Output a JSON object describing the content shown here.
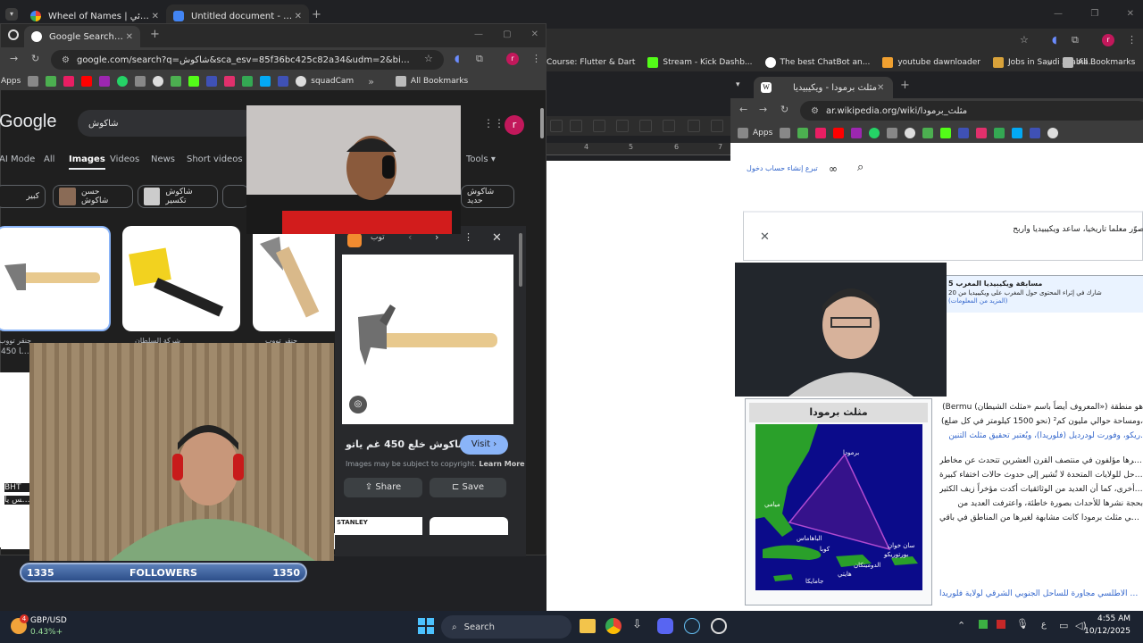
{
  "back_window": {
    "tabs": [
      {
        "label": "Wheel of Names | عجلة الأسم العشوائي"
      },
      {
        "label": "Untitled document - Google Do"
      }
    ],
    "bookmarks": [
      "Course: Flutter & Dart",
      "Stream - Kick Dashb...",
      "The best ChatBot an...",
      "youtube dawnloader",
      "Jobs in Saudi Arabia..."
    ],
    "all_bookmarks": "All Bookmarks",
    "ruler_marks": [
      "4",
      "5",
      "6",
      "7"
    ]
  },
  "google_window": {
    "tab_title": "Google Search - شاكوش",
    "url": "google.com/search?q=شاكوش&sca_esv=85f36bc425c82a34&udm=2&biw=952&bih=783...",
    "bookmarks": [
      "Apps",
      "squadCam"
    ],
    "all_bookmarks": "All Bookmarks",
    "logo": "Google",
    "query": "شاكوش",
    "avatar": "r",
    "tabs": [
      "AI Mode",
      "All",
      "Images",
      "Videos",
      "News",
      "Short videos"
    ],
    "tools": "Tools",
    "chips": [
      "كبير",
      "حسن شاكوش",
      "شاكوش تكسير",
      "شاكوش حديد"
    ],
    "result_sources": [
      "شركة السلطان",
      "جنقر تووب",
      "جنقر تووب"
    ],
    "result_snippet": "جنقر تووب",
    "left_snippets": [
      "450 عم يا",
      "BHT",
      "بولكس يا"
    ],
    "panel": {
      "source": "توب",
      "title": "شاكوش خلع 450 غم ياتو",
      "visit": "Visit",
      "copyright": "Images may be subject to copyright.",
      "learn_more": "Learn More",
      "share": "Share",
      "save": "Save",
      "related_label": "STANLEY"
    }
  },
  "wiki_window": {
    "tab_title": "مثلث برمودا - ويكيبيديا",
    "url": "ar.wikipedia.org/wiki/مثلث_برمودا",
    "bookmarks": [
      "Apps"
    ],
    "links": "تبرع إنشاء حساب دخول",
    "banner_text": "صوّر معلماً تاريخياً، ساعد ويكيبيديا واربح!",
    "notice_title": "مسابقة ويكيبيديا المغرب 5",
    "notice_line1": "شارك في إثراء المحتوى حول المغرب على ويكيبيديا من 20",
    "notice_line2": "(المزيد من المعلومات)",
    "infobox_title": "مثلث برمودا",
    "map_labels": [
      "برمودا",
      "ميامي",
      "الباهاماس",
      "كوبا",
      "هايتي",
      "الدومينكان",
      "سان خوان",
      "بورتوريكو",
      "جامايكا"
    ],
    "para1": [
      "(Bermu (المعروف أيضاً باسم «مثلث الشيطان») هو منطقة",
      "(نحو 1500 كيلومتر في كل ضلع) ومساحة حوالي مليون كم²،",
      "ريكو، وفورت لودرديل (فلوريدا)، ويُعتبر تحقيق مثلث التنين."
    ],
    "para2": [
      "نشرها مؤلفون في منتصف القرن العشرين تتحدث عن مخاطر",
      "السواحل للولايات المتحدة لا تُشير إلى حدوث حالات اختفاء كبيرة",
      "ملق أخرى، كما أن العديد من الوثائقيات أكدت مؤخراً زيف الكثير",
      "بحجة نشرها للأحداث بصورة خاطئة، واعترفت العديد من",
      "الاختفاء في مثلث برمودا كانت مشابهة لغيرها من المناطق في باقي"
    ],
    "footer": "محيط الأطلسي مجاورة للساحل الجنوبي الشرقي لولاية فلوريدا،"
  },
  "overlay": {
    "followers_current": "1335",
    "followers_label": "FOLLOWERS",
    "followers_goal": "1350",
    "progress_fraction": 0.0
  },
  "taskbar": {
    "widget_title": "GBP/USD",
    "widget_value": "0.43%+",
    "widget_badge": "4",
    "search": "Search",
    "ime": "ع",
    "time": "4:55 AM",
    "date": "10/12/2025"
  }
}
